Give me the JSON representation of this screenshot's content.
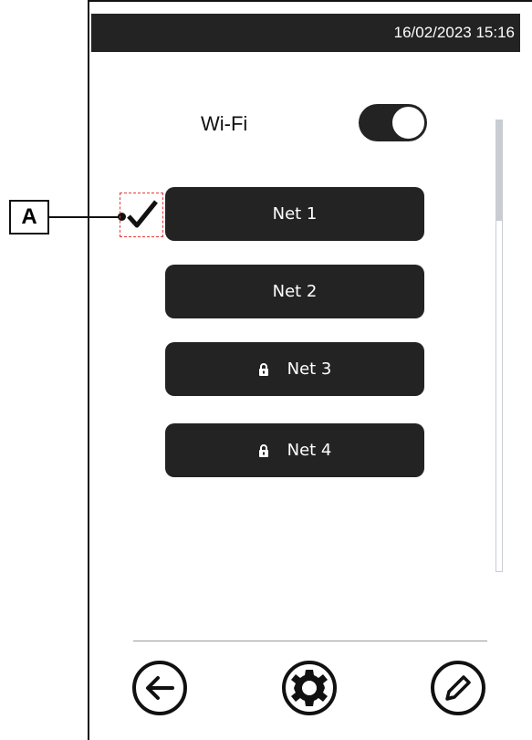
{
  "status_bar": {
    "datetime": "16/02/2023 15:16"
  },
  "wifi": {
    "label": "Wi-Fi",
    "enabled": true
  },
  "networks": [
    {
      "label": "Net  1",
      "locked": false,
      "connected": true
    },
    {
      "label": "Net  2",
      "locked": false,
      "connected": false
    },
    {
      "label": "Net  3",
      "locked": true,
      "connected": false
    },
    {
      "label": "Net  4",
      "locked": true,
      "connected": false
    }
  ],
  "callout": {
    "label": "A"
  },
  "toolbar": {
    "back_icon": "arrow-left-circle-icon",
    "settings_icon": "gear-circle-icon",
    "edit_icon": "pencil-circle-icon"
  },
  "colors": {
    "dark": "#232323",
    "highlight": "#e23b3b",
    "scrollbar": "#c9ccd3"
  }
}
